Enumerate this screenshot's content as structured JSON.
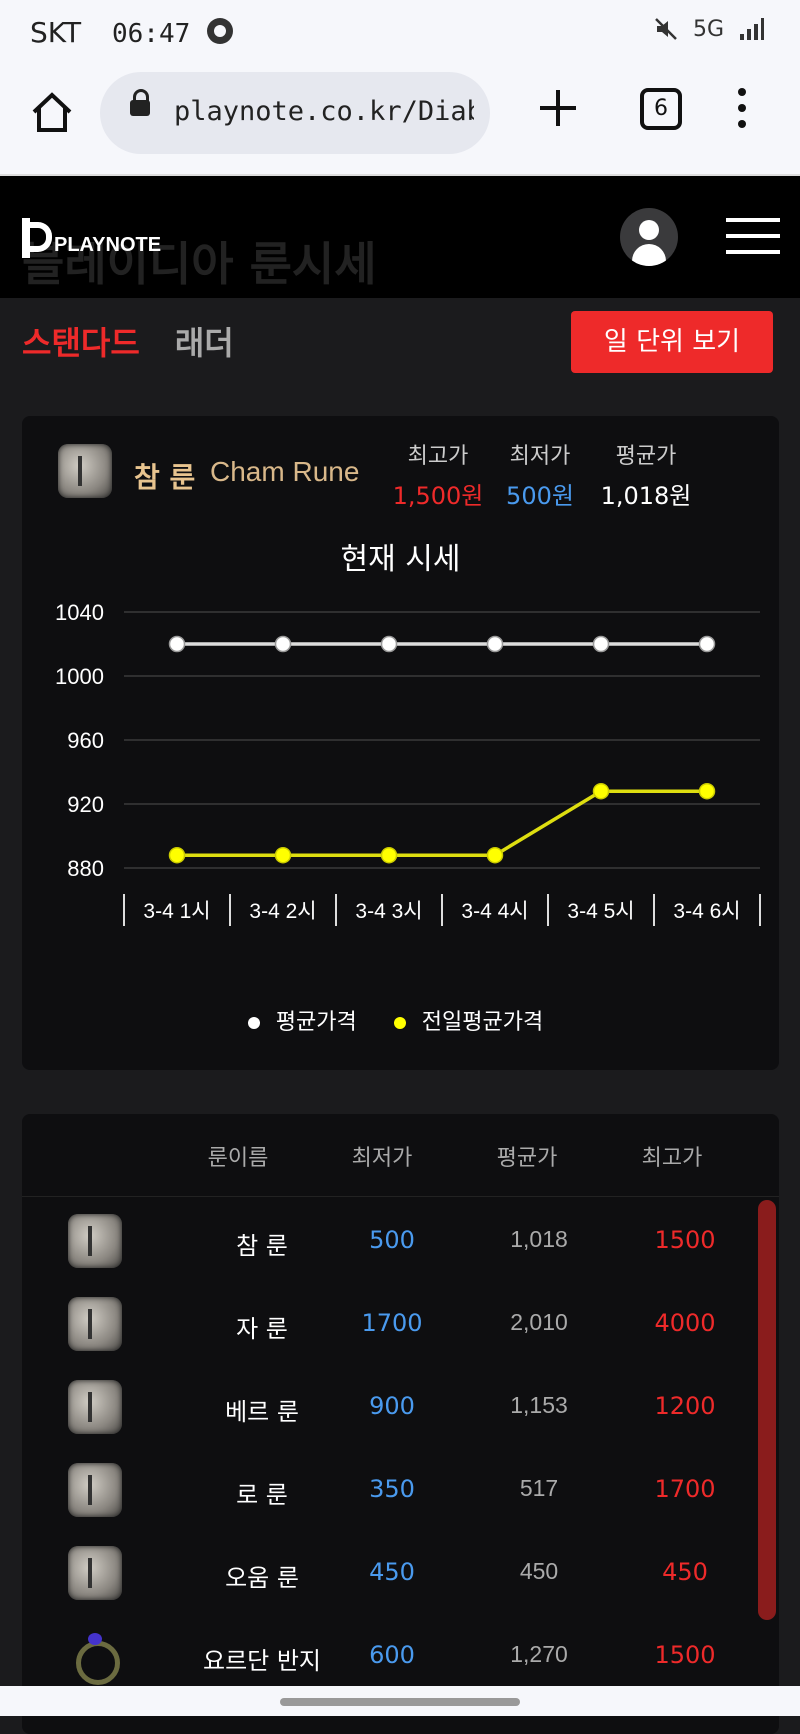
{
  "status": {
    "carrier": "SKT",
    "time": "06:47",
    "network": "5G"
  },
  "browser": {
    "url": "playnote.co.kr/Diablo/Ru",
    "tab_count": "6"
  },
  "header": {
    "logo_text": "PLAYNOTE",
    "ghost_title": "블레이디아 룬시세"
  },
  "modes": {
    "standard": "스탠다드",
    "ladder": "래더",
    "day_button": "일 단위 보기"
  },
  "rune": {
    "name_kor": "참 룬",
    "name_eng": "Cham Rune",
    "max_label": "최고가",
    "min_label": "최저가",
    "avg_label": "평균가",
    "max_value": "1,500원",
    "min_value": "500원",
    "avg_value": "1,018원"
  },
  "chart_title": "현재 시세",
  "chart_data": {
    "type": "line",
    "categories": [
      "3-4 1시",
      "3-4 2시",
      "3-4 3시",
      "3-4 4시",
      "3-4 5시",
      "3-4 6시"
    ],
    "series": [
      {
        "name": "평균가격",
        "values": [
          1020,
          1020,
          1020,
          1020,
          1020,
          1020
        ],
        "color": "#ffffff"
      },
      {
        "name": "전일평균가격",
        "values": [
          888,
          888,
          888,
          888,
          928,
          928
        ],
        "color": "#ffff00"
      }
    ],
    "ylim": [
      880,
      1040
    ],
    "yticks": [
      1040,
      1000,
      960,
      920,
      880
    ]
  },
  "table": {
    "headers": [
      "룬이름",
      "최저가",
      "평균가",
      "최고가"
    ],
    "rows": [
      {
        "name": "참 룬",
        "min": "500",
        "avg": "1,018",
        "max": "1500",
        "icon": "rune-icon"
      },
      {
        "name": "자 룬",
        "min": "1700",
        "avg": "2,010",
        "max": "4000",
        "icon": "rune-icon"
      },
      {
        "name": "베르 룬",
        "min": "900",
        "avg": "1,153",
        "max": "1200",
        "icon": "rune-icon"
      },
      {
        "name": "로 룬",
        "min": "350",
        "avg": "517",
        "max": "1700",
        "icon": "rune-icon"
      },
      {
        "name": "오움 룬",
        "min": "450",
        "avg": "450",
        "max": "450",
        "icon": "rune-icon"
      },
      {
        "name": "요르단 반지",
        "min": "600",
        "avg": "1,270",
        "max": "1500",
        "icon": "ring-icon"
      }
    ]
  }
}
